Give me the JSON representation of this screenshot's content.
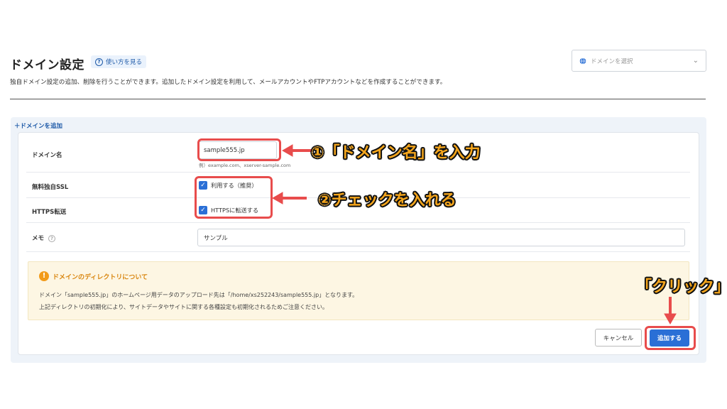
{
  "header": {
    "title": "ドメイン設定",
    "help_label": "使い方を見る",
    "domain_select_placeholder": "ドメインを選択",
    "description": "独自ドメイン設定の追加、削除を行うことができます。追加したドメイン設定を利用して、メールアカウントやFTPアカウントなどを作成することができます。"
  },
  "panel": {
    "add_link": "＋ドメインを追加"
  },
  "form": {
    "domain_label": "ドメイン名",
    "domain_value": "sample555.jp",
    "domain_hint": "例）example.com、xserver-sample.com",
    "ssl_label": "無料独自SSL",
    "ssl_checkbox_label": "利用する（推奨）",
    "ssl_checked": true,
    "https_label": "HTTPS転送",
    "https_checkbox_label": "HTTPSに転送する",
    "https_checked": true,
    "memo_label": "メモ",
    "memo_value": "サンプル"
  },
  "notice": {
    "title": "ドメインのディレクトリについて",
    "line1": "ドメイン「sample555.jp」のホームページ用データのアップロード先は「/home/xs252243/sample555.jp」となります。",
    "line2": "上記ディレクトリの初期化により、サイトデータやサイトに関する各種設定も初期化されるためご注意ください。"
  },
  "buttons": {
    "cancel": "キャンセル",
    "submit": "追加する"
  },
  "annotations": {
    "step1": "①「ドメイン名」を入力",
    "step2": "②チェックを入れる",
    "step3": "「クリック」",
    "box_color": "#e84c4c",
    "text_color": "#f4a51c"
  },
  "colors": {
    "accent": "#2a6fd6",
    "warning": "#f29b1a"
  }
}
